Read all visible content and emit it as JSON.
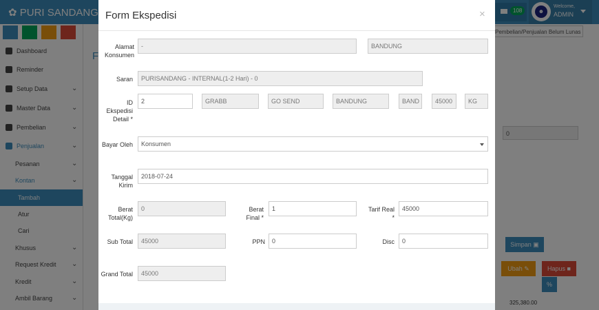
{
  "header": {
    "brand": "PURI SANDANG - LE",
    "mail_count": "108",
    "welcome": "Welcome,",
    "user": "ADMIN"
  },
  "sidebar": {
    "items": [
      {
        "label": "Dashboard"
      },
      {
        "label": "Reminder"
      },
      {
        "label": "Setup Data"
      },
      {
        "label": "Master Data"
      },
      {
        "label": "Pembelian"
      },
      {
        "label": "Penjualan"
      },
      {
        "label": "Pesanan"
      },
      {
        "label": "Kontan"
      },
      {
        "label": "Tambah"
      },
      {
        "label": "Atur"
      },
      {
        "label": "Cari"
      },
      {
        "label": "Khusus"
      },
      {
        "label": "Request Kredit"
      },
      {
        "label": "Kredit"
      },
      {
        "label": "Ambil Barang"
      }
    ]
  },
  "background": {
    "notice": "Pembelian/Penjualan Belum Lunas",
    "title_partial": "F",
    "field_value": "0",
    "simpan": "Simpan",
    "ubah": "Ubah",
    "hapus": "Hapus",
    "pct": "%",
    "total": "325,380.00"
  },
  "modal": {
    "title": "Form Ekspedisi",
    "close": "×",
    "alamat_label": "Alamat Konsumen",
    "alamat_value": "-",
    "kota_value": "BANDUNG",
    "saran_label": "Saran",
    "saran_value": "PURISANDANG - INTERNAL(1-2 Hari) - 0",
    "id_label": "ID Ekspedisi Detail *",
    "id_value": "2",
    "detail_fields": [
      "GRABB",
      "GO SEND",
      "BANDUNG",
      "BAND",
      "45000",
      "KG"
    ],
    "bayar_label": "Bayar Oleh",
    "bayar_value": "Konsumen",
    "tanggal_label": "Tanggal Kirim",
    "tanggal_value": "2018-07-24",
    "berat_total_label": "Berat Total(Kg)",
    "berat_total_value": "0",
    "berat_final_label": "Berat Final *",
    "berat_final_value": "1",
    "tarif_label": "Tarif Real *",
    "tarif_value": "45000",
    "subtotal_label": "Sub Total",
    "subtotal_value": "45000",
    "ppn_label": "PPN",
    "ppn_value": "0",
    "disc_label": "Disc",
    "disc_value": "0",
    "grand_label": "Grand Total",
    "grand_value": "45000"
  },
  "colors": {
    "primary": "#3c8dbc",
    "success": "#00a65a",
    "warning": "#f39c12",
    "danger": "#dd4b39",
    "info": "#3c8dbc"
  }
}
